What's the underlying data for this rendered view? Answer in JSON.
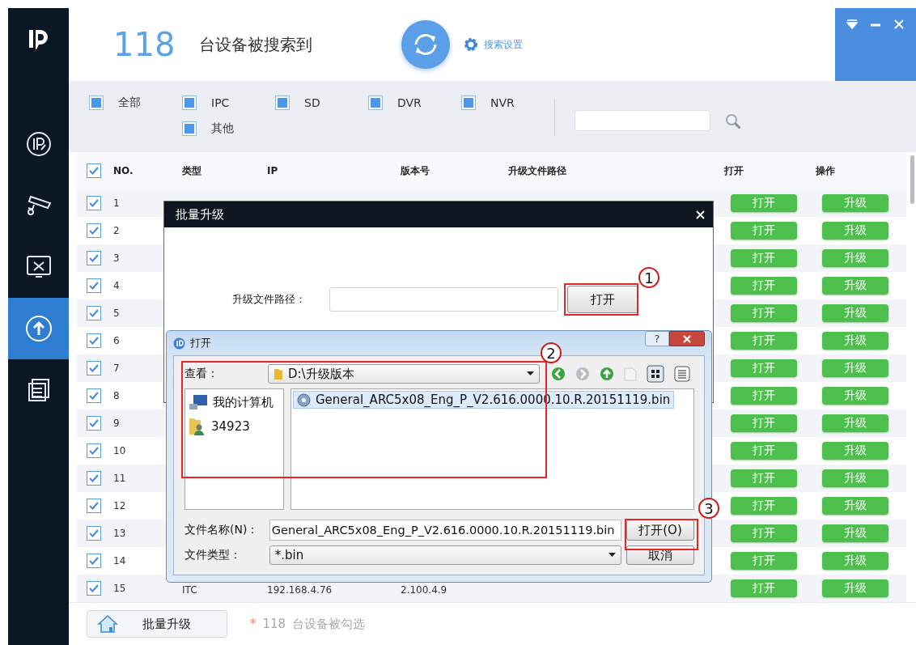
{
  "sidebar": {
    "items": [
      {
        "kind": "ip",
        "selected": false
      },
      {
        "kind": "camera",
        "selected": false
      },
      {
        "kind": "tools",
        "selected": false
      },
      {
        "kind": "upgrade",
        "selected": true
      },
      {
        "kind": "windows",
        "selected": false
      }
    ]
  },
  "header": {
    "count": "118",
    "text": "台设备被搜索到",
    "settings": "搜索设置"
  },
  "filters": [
    {
      "label": "全部",
      "checked": true
    },
    {
      "label": "IPC",
      "checked": true
    },
    {
      "label": "SD",
      "checked": true
    },
    {
      "label": "DVR",
      "checked": true
    },
    {
      "label": "NVR",
      "checked": true
    },
    {
      "label": "其他",
      "checked": true
    }
  ],
  "table": {
    "all_checked": true,
    "columns": [
      "NO.",
      "类型",
      "IP",
      "版本号",
      "升级文件路径",
      "打开",
      "操作"
    ],
    "rows": [
      {
        "no": "1",
        "checked": true,
        "open": "打开",
        "action": "升级"
      },
      {
        "no": "2",
        "checked": true,
        "open": "打开",
        "action": "升级"
      },
      {
        "no": "3",
        "checked": true,
        "open": "打开",
        "action": "升级"
      },
      {
        "no": "4",
        "checked": true,
        "open": "打开",
        "action": "升级"
      },
      {
        "no": "5",
        "checked": true,
        "open": "打开",
        "action": "升级"
      },
      {
        "no": "6",
        "checked": true,
        "open": "打开",
        "action": "升级"
      },
      {
        "no": "7",
        "checked": true,
        "open": "打开",
        "action": "升级"
      },
      {
        "no": "8",
        "checked": true,
        "open": "打开",
        "action": "升级"
      },
      {
        "no": "9",
        "checked": true,
        "open": "打开",
        "action": "升级"
      },
      {
        "no": "10",
        "checked": true,
        "open": "打开",
        "action": "升级"
      },
      {
        "no": "11",
        "checked": true,
        "open": "打开",
        "action": "升级"
      },
      {
        "no": "12",
        "checked": true,
        "open": "打开",
        "action": "升级"
      },
      {
        "no": "13",
        "checked": true,
        "open": "打开",
        "action": "升级"
      },
      {
        "no": "14",
        "checked": true,
        "open": "打开",
        "action": "升级"
      },
      {
        "no": "15",
        "checked": true,
        "type": "ITC",
        "ip": "192.168.4.76",
        "version": "2.100.4.9",
        "open": "打开",
        "action": "升级"
      }
    ]
  },
  "footer": {
    "button": "批量升级",
    "mark": "*",
    "count": "118",
    "text": "台设备被勾选"
  },
  "batch_dialog": {
    "title": "批量升级",
    "path_label": "升级文件路径：",
    "open_button": "打开"
  },
  "file_dialog": {
    "title": "打开",
    "help": "?",
    "look_in_label": "查看：",
    "folder": "D:\\升级版本",
    "places": [
      {
        "kind": "computer",
        "label": "我的计算机"
      },
      {
        "kind": "user",
        "label": "34923"
      }
    ],
    "files": [
      {
        "name": "General_ARC5x08_Eng_P_V2.616.0000.10.R.20151119.bin",
        "selected": true
      }
    ],
    "filename_label": "文件名称(N)：",
    "filename": "General_ARC5x08_Eng_P_V2.616.0000.10.R.20151119.bin",
    "filetype_label": "文件类型：",
    "filetype": "*.bin",
    "open_button": "打开(O)",
    "cancel_button": "取消"
  },
  "annotations": [
    {
      "label": "1"
    },
    {
      "label": "2"
    },
    {
      "label": "3"
    }
  ]
}
